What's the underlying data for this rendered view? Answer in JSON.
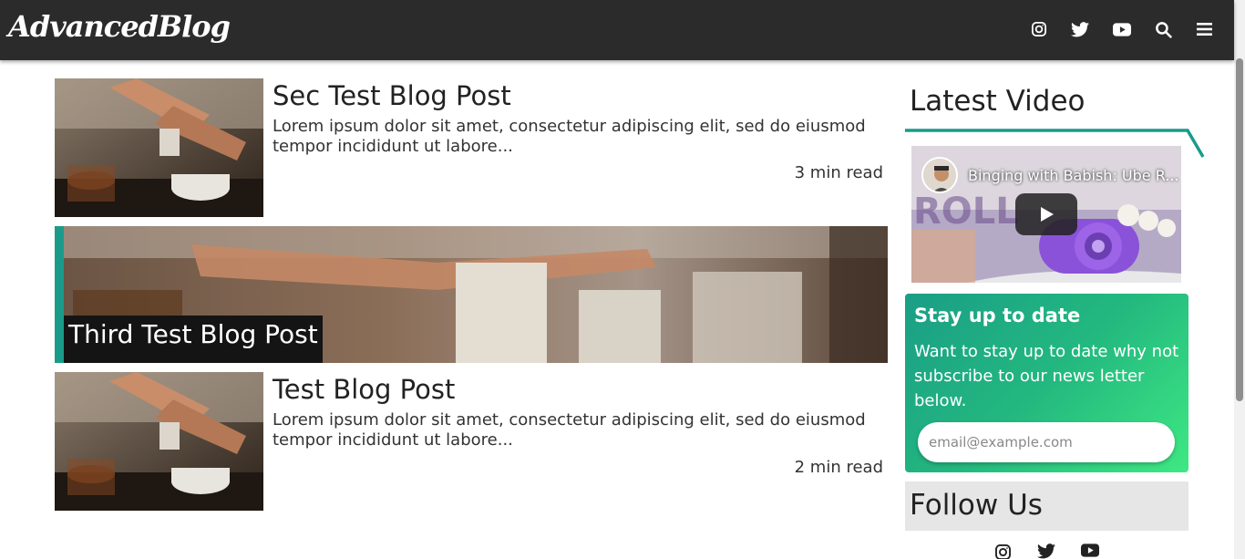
{
  "header": {
    "logo": "AdvancedBlog",
    "icons": [
      "instagram-icon",
      "twitter-icon",
      "youtube-icon",
      "search-icon",
      "menu-icon"
    ]
  },
  "posts": [
    {
      "title": "Sec Test Blog Post",
      "excerpt": "Lorem ipsum dolor sit amet, consectetur adipiscing elit, sed do eiusmod tempor incididunt ut labore...",
      "read_time": "3 min read"
    },
    {
      "title": "Third Test Blog Post",
      "featured": true
    },
    {
      "title": "Test Blog Post",
      "excerpt": "Lorem ipsum dolor sit amet, consectetur adipiscing elit, sed do eiusmod tempor incididunt ut labore...",
      "read_time": "2 min read"
    }
  ],
  "sidebar": {
    "latest_video": {
      "heading": "Latest Video",
      "video_title": "Binging with Babish: Ube R...",
      "accent": "#1a9b8a"
    },
    "subscribe": {
      "title": "Stay up to date",
      "text": "Want to stay up to date why not subscribe to our news letter below.",
      "placeholder": "email@example.com"
    },
    "follow": {
      "heading": "Follow Us",
      "icons": [
        "instagram-icon",
        "twitter-icon",
        "youtube-icon"
      ]
    }
  },
  "colors": {
    "header_bg": "#2b2b2b",
    "accent": "#1a9b8a",
    "gradient_end": "#3ee882"
  }
}
